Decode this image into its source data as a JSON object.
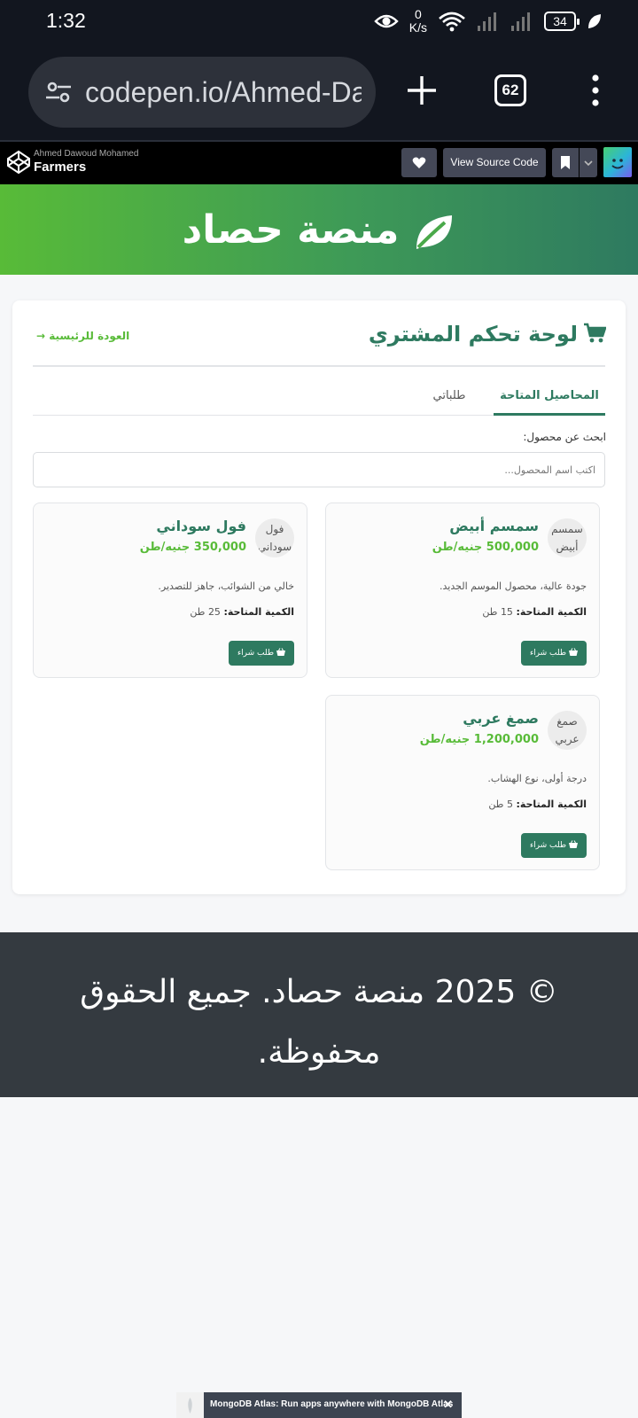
{
  "status_bar": {
    "time": "1:32",
    "net_speed_value": "0",
    "net_speed_unit": "K/s",
    "battery": "34"
  },
  "browser": {
    "url": "codepen.io/Ahmed-Dawoud",
    "tab_count": "62"
  },
  "codepen": {
    "author": "Ahmed Dawoud Mohamed",
    "pen_title": "Farmers",
    "view_source_label": "View Source Code"
  },
  "site": {
    "title": "منصة حصاد",
    "brand_color": "#2e7a60",
    "accent_color": "#58bb38"
  },
  "dashboard": {
    "title": "لوحة تحكم المشتري",
    "back_link": "العودة للرئيسية →",
    "tabs": [
      {
        "label": "المحاصيل المتاحة",
        "active": true
      },
      {
        "label": "طلباتي",
        "active": false
      }
    ],
    "search_label": "ابحث عن محصول:",
    "search_placeholder": "اكتب اسم المحصول...",
    "quantity_label": "الكمية المتاحة:",
    "buy_label": "طلب شراء",
    "products": [
      {
        "img_alt": "سمسم أبيض",
        "name": "سمسم أبيض",
        "price": "500,000 جنيه/طن",
        "description": "جودة عالية، محصول الموسم الجديد.",
        "quantity": "15 طن"
      },
      {
        "img_alt": "فول سوداني",
        "name": "فول سوداني",
        "price": "350,000 جنيه/طن",
        "description": "خالي من الشوائب، جاهز للتصدير.",
        "quantity": "25 طن"
      },
      {
        "img_alt": "صمغ عربي",
        "name": "صمغ عربي",
        "price": "1,200,000 جنيه/طن",
        "description": "درجة أولى، نوع الهشاب.",
        "quantity": "5 طن"
      }
    ]
  },
  "footer": {
    "text": "© 2025 منصة حصاد. جميع الحقوق محفوظة."
  },
  "ad": {
    "text": "MongoDB Atlas: Run apps anywhere with MongoDB Atlas",
    "close": "✕"
  }
}
